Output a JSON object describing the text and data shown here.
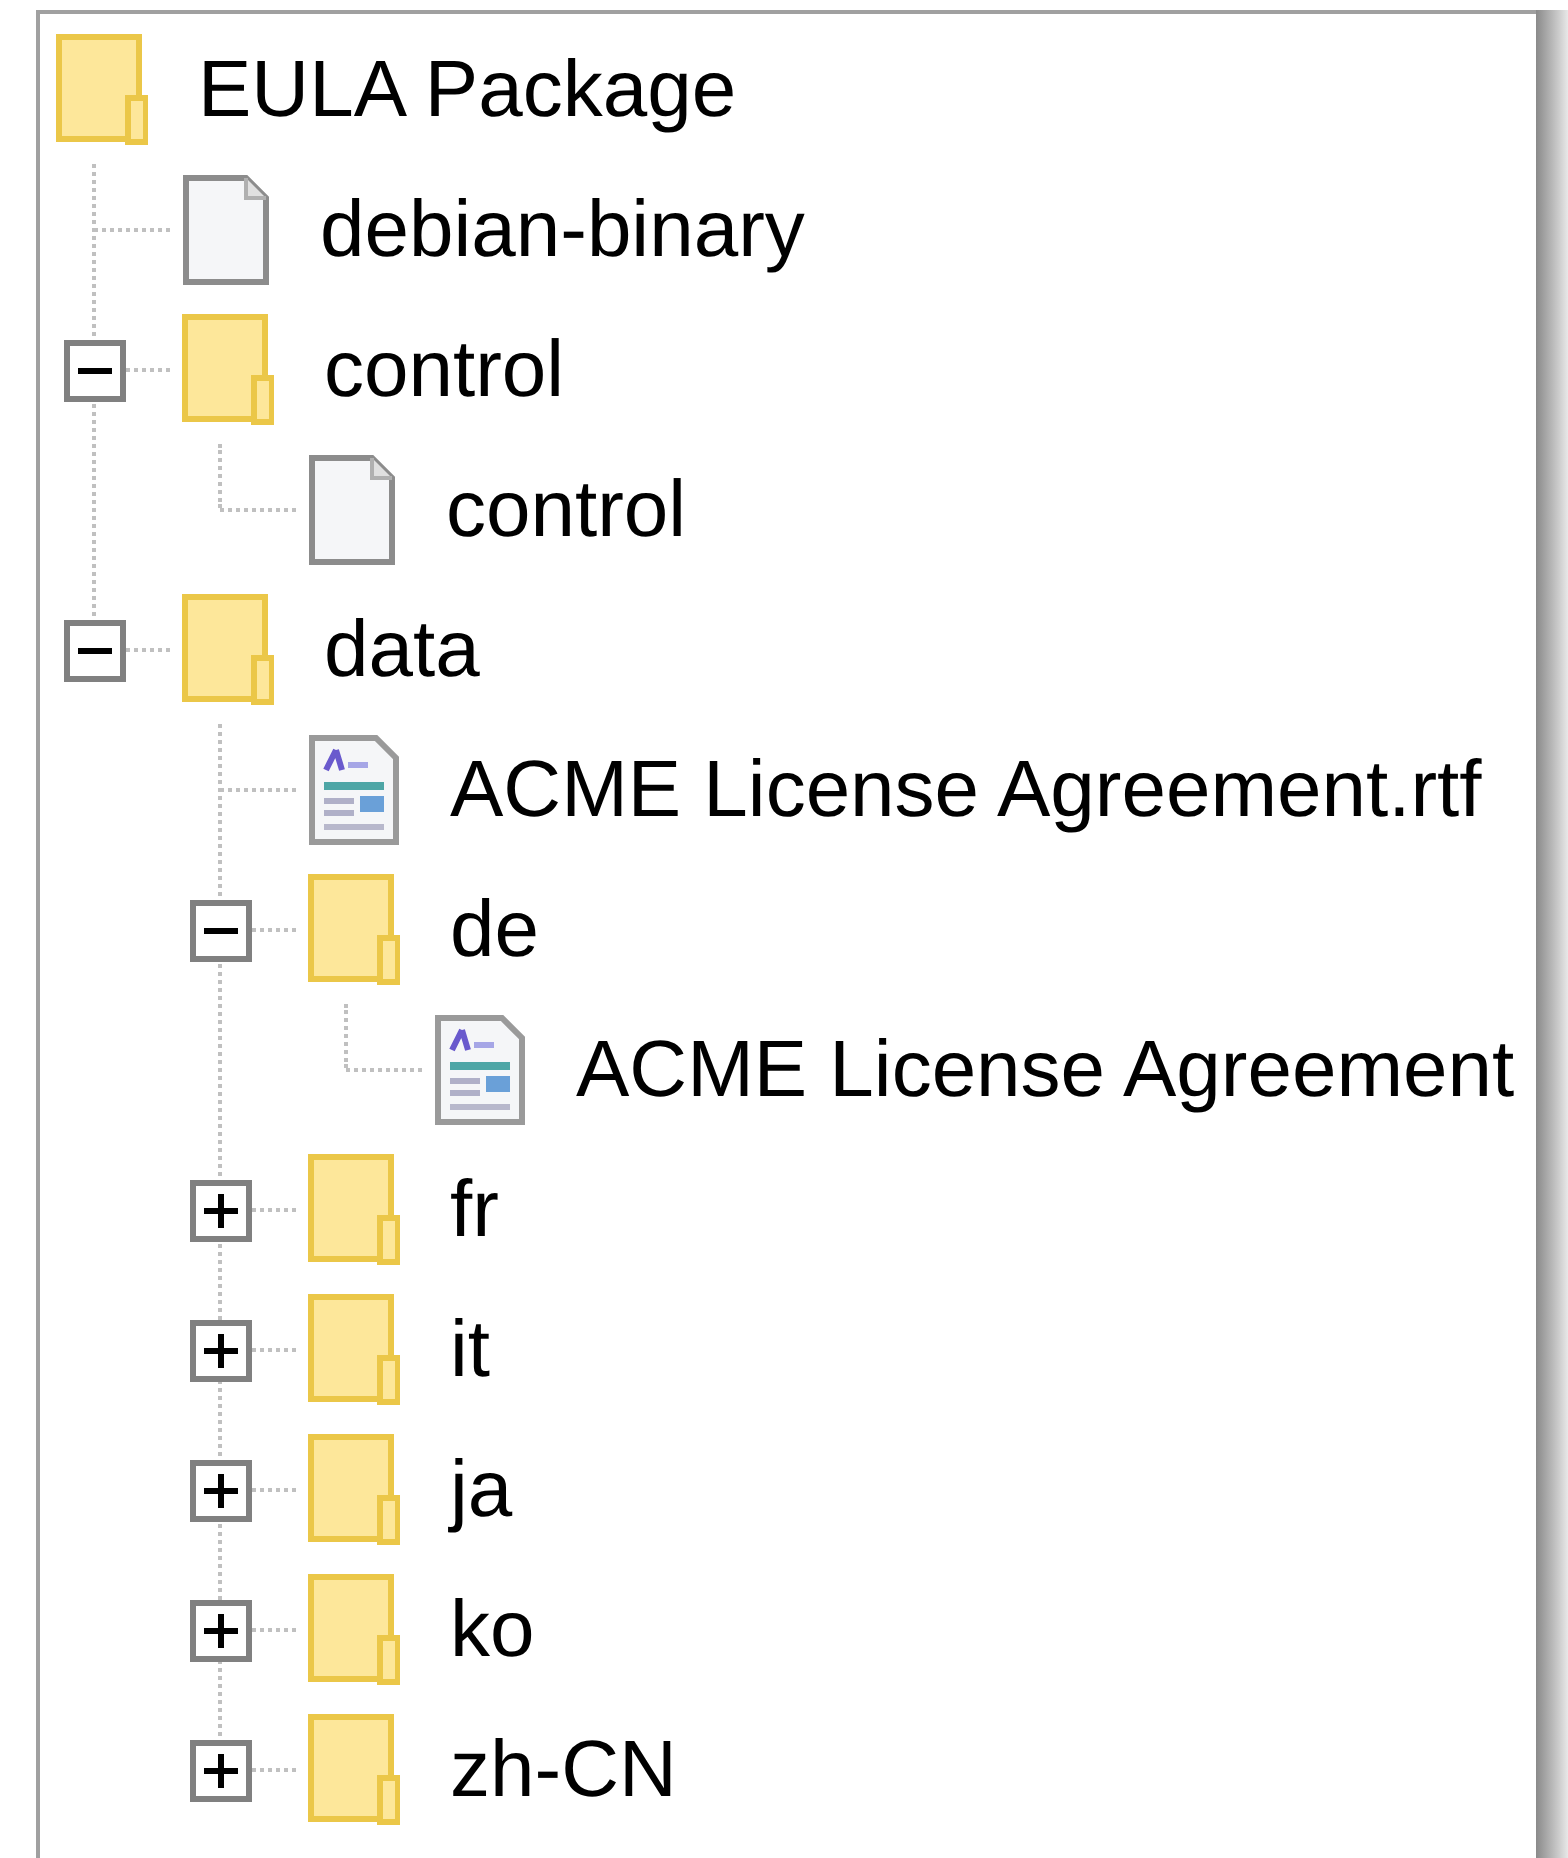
{
  "tree": [
    {
      "label": "EULA Package",
      "kind": "folder",
      "children": [
        {
          "label": "debian-binary",
          "kind": "file"
        },
        {
          "label": "control",
          "kind": "folder",
          "expanded": true,
          "children": [
            {
              "label": "control",
              "kind": "file"
            }
          ]
        },
        {
          "label": "data",
          "kind": "folder",
          "expanded": true,
          "children": [
            {
              "label": "ACME License Agreement.rtf",
              "kind": "document"
            },
            {
              "label": "de",
              "kind": "folder",
              "expanded": true,
              "children": [
                {
                  "label": "ACME License Agreement",
                  "kind": "document"
                }
              ]
            },
            {
              "label": "fr",
              "kind": "folder",
              "expanded": false
            },
            {
              "label": "it",
              "kind": "folder",
              "expanded": false
            },
            {
              "label": "ja",
              "kind": "folder",
              "expanded": false
            },
            {
              "label": "ko",
              "kind": "folder",
              "expanded": false
            },
            {
              "label": "zh-CN",
              "kind": "folder",
              "expanded": false
            }
          ]
        }
      ]
    }
  ]
}
